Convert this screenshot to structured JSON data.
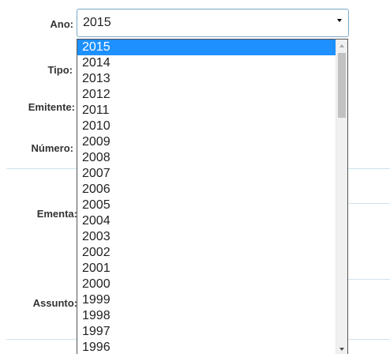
{
  "form": {
    "labels": {
      "ano": "Ano:",
      "tipo": "Tipo:",
      "emitente": "Emitente:",
      "numero": "Número:",
      "ementa": "Ementa:",
      "assunto": "Assunto:"
    }
  },
  "year_select": {
    "selected": "2015",
    "options": [
      "2015",
      "2014",
      "2013",
      "2012",
      "2011",
      "2010",
      "2009",
      "2008",
      "2007",
      "2006",
      "2005",
      "2004",
      "2003",
      "2002",
      "2001",
      "2000",
      "1999",
      "1998",
      "1997",
      "1996"
    ],
    "highlight_color": "#1e90ff",
    "scroll_position": 0
  }
}
